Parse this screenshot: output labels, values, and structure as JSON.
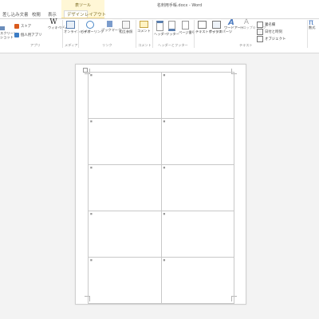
{
  "window": {
    "title": "名刺用手帳.docx - Word"
  },
  "tabs": [
    "差し込み文書",
    "校閲",
    "表示",
    "デザイン",
    "レイアウト"
  ],
  "context_tab_group": "表ツール",
  "ribbon": {
    "left_partial": {
      "label1": "スクリーン",
      "label2": "ショット"
    },
    "apps": {
      "store": "ストア",
      "personal_apps": "個人用アプリ"
    },
    "wikipedia": "ウィキペディア",
    "online_video": "オンラインビデオ",
    "hyperlink": "ハイパーリンク",
    "bookmark": "ブックマーク",
    "cross_reference": "相互参照",
    "comment": "コメント",
    "header": "ヘッダー",
    "footer": "フッター",
    "page_number": "ページ番号",
    "text_box": "テキストボックス",
    "quick_parts": "クイックパーツ",
    "wordart": "ワードアート",
    "drop_cap": "ドロップキャップ",
    "signature_line": "署名欄",
    "date_time": "日付と時刻",
    "object": "オブジェクト",
    "equation": "数式",
    "groups": {
      "apps": "アプリ",
      "media": "メディア",
      "links": "リンク",
      "comments": "コメント",
      "header_footer": "ヘッダーとフッター",
      "text": "テキスト"
    }
  }
}
